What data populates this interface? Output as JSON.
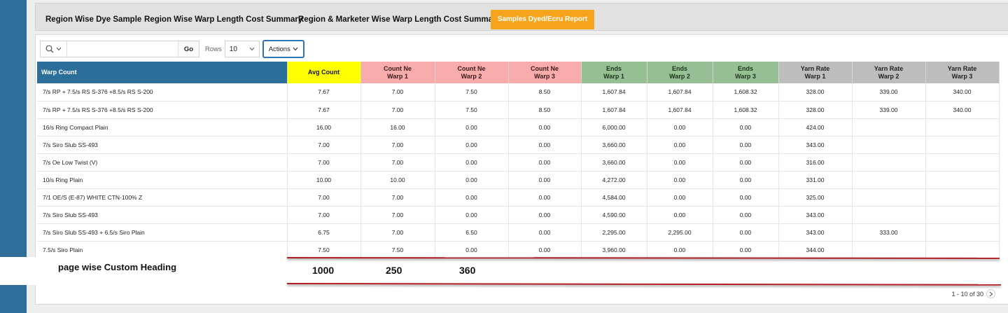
{
  "tabs": [
    {
      "label": "Region Wise Dye Sample",
      "active": false
    },
    {
      "label": "Region Wise Warp Length Cost Summary",
      "active": false
    },
    {
      "label": "Region & Marketer Wise Warp Length Cost Summary",
      "active": false
    },
    {
      "label": "Samples Dyed/Ecru Report",
      "active": true
    }
  ],
  "toolbar": {
    "search_icon": "search-icon",
    "search_value": "",
    "go_label": "Go",
    "rows_label": "Rows",
    "rows_value": "10",
    "actions_label": "Actions"
  },
  "columns": {
    "warp": "Warp Count",
    "avg": "Avg Count",
    "cnw1_a": "Count Ne",
    "cnw1_b": "Warp 1",
    "cnw2_a": "Count Ne",
    "cnw2_b": "Warp 2",
    "cnw3_a": "Count Ne",
    "cnw3_b": "Warp 3",
    "ew1_a": "Ends",
    "ew1_b": "Warp 1",
    "ew2_a": "Ends",
    "ew2_b": "Warp 2",
    "ew3_a": "Ends",
    "ew3_b": "Warp 3",
    "yr1_a": "Yarn Rate",
    "yr1_b": "Warp 1",
    "yr2_a": "Yarn Rate",
    "yr2_b": "Warp 2",
    "yr3_a": "Yarn Rate",
    "yr3_b": "Warp 3"
  },
  "rows": [
    [
      "7/s RP + 7.5/s RS S-376 +8.5/s RS S-200",
      "7.67",
      "7.00",
      "7.50",
      "8.50",
      "1,607.84",
      "1,607.84",
      "1,608.32",
      "328.00",
      "339.00",
      "340.00"
    ],
    [
      "7/s RP + 7.5/s RS S-376 +8.5/s RS S-200",
      "7.67",
      "7.00",
      "7.50",
      "8.50",
      "1,607.84",
      "1,607.84",
      "1,608.32",
      "328.00",
      "339.00",
      "340.00"
    ],
    [
      "16/s Ring Compact Plain",
      "16.00",
      "16.00",
      "0.00",
      "0.00",
      "6,000.00",
      "0.00",
      "0.00",
      "424.00",
      "",
      ""
    ],
    [
      "7/s Siro Slub SS-493",
      "7.00",
      "7.00",
      "0.00",
      "0.00",
      "3,660.00",
      "0.00",
      "0.00",
      "343.00",
      "",
      ""
    ],
    [
      "7/s Oe Low Twist (V)",
      "7.00",
      "7.00",
      "0.00",
      "0.00",
      "3,660.00",
      "0.00",
      "0.00",
      "316.00",
      "",
      ""
    ],
    [
      "10/s Ring Plain",
      "10.00",
      "10.00",
      "0.00",
      "0.00",
      "4,272.00",
      "0.00",
      "0.00",
      "331.00",
      "",
      ""
    ],
    [
      "7/1 OE/S (E-87) WHITE CTN-100% Z",
      "7.00",
      "7.00",
      "0.00",
      "0.00",
      "4,584.00",
      "0.00",
      "0.00",
      "325.00",
      "",
      ""
    ],
    [
      "7/s Siro Slub SS-493",
      "7.00",
      "7.00",
      "0.00",
      "0.00",
      "4,590.00",
      "0.00",
      "0.00",
      "343.00",
      "",
      ""
    ],
    [
      "7/s Siro Slub SS-493 + 6.5/s Siro Plain",
      "6.75",
      "7.00",
      "6.50",
      "0.00",
      "2,295.00",
      "2,295.00",
      "0.00",
      "343.00",
      "333.00",
      ""
    ],
    [
      "7.5/s Siro Plain",
      "7.50",
      "7.50",
      "0.00",
      "0.00",
      "3,960.00",
      "0.00",
      "0.00",
      "344.00",
      "",
      ""
    ]
  ],
  "overlay": {
    "heading": "page wise Custom Heading",
    "values": [
      "1000",
      "250",
      "360"
    ]
  },
  "pagination": {
    "range": "1 - 10 of 30",
    "next_icon": "chevron-right-icon"
  }
}
